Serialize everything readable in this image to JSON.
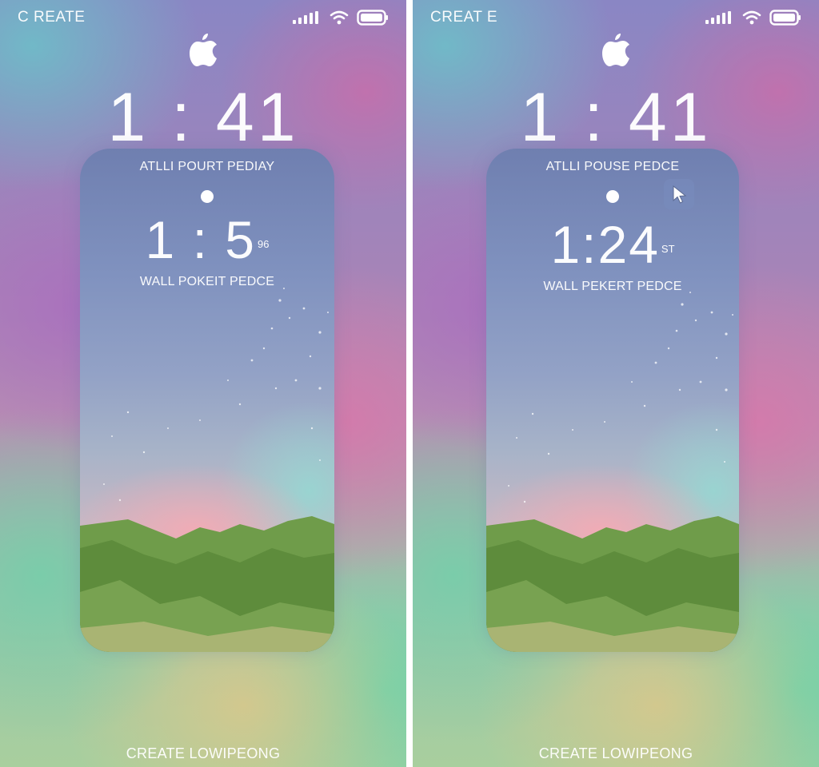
{
  "panels": [
    {
      "status_label": "C REATE",
      "big_time": "1 : 41",
      "card": {
        "title": "ATLLI POURT PEDIAY",
        "clock": "1 : 5",
        "clock_sup": "96",
        "subtitle": "WALL POKEIT PEDCE"
      },
      "bottom_label": "CREATE LOWIPEONG"
    },
    {
      "status_label": "CREAT E",
      "big_time": "1 : 41",
      "card": {
        "title": "ATLLI POUSE PEDCE",
        "clock": "1:24",
        "clock_sup": "ST",
        "subtitle": "WALL PEKERT PEDCE"
      },
      "bottom_label": "CREATE LOWIPEONG"
    }
  ],
  "icons": {
    "signal": "signal-icon",
    "wifi": "wifi-icon",
    "battery": "battery-icon",
    "logo": "apple-logo-icon",
    "cursor": "cursor-arrow-icon"
  },
  "colors": {
    "text": "#ffffff",
    "mountain_green": "#6a9a48",
    "mountain_dark": "#4f7d35"
  }
}
